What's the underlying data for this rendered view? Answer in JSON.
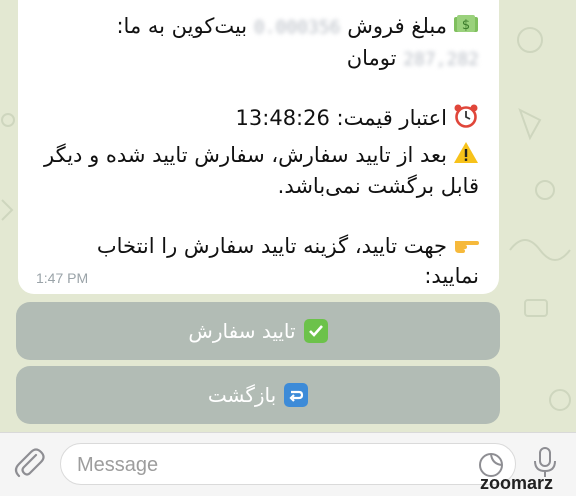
{
  "message": {
    "line1": "مبلغ فروش",
    "blurred_amount": "0.000356",
    "line1_end": "بیت‌کوین به ما:",
    "blurred_toman": "287,282",
    "line2_end": "تومان",
    "line3": "اعتبار قیمت: 13:48:26",
    "line4": "بعد از تایید سفارش، سفارش تایید شده و دیگر",
    "line5": "قابل برگشت نمی‌باشد.",
    "line6": "جهت تایید، گزینه تایید سفارش را انتخاب",
    "line7": "نمایید:",
    "time": "1:47 PM",
    "icons": [
      "money-bag-icon",
      "alarm-clock-icon",
      "warning-icon",
      "pointing-hand-icon"
    ]
  },
  "keyboard": {
    "confirm_label": "تایید سفارش",
    "back_label": "بازگشت",
    "confirm_icon": "check-mark-icon",
    "back_icon": "return-arrow-icon"
  },
  "composer": {
    "placeholder": "Message"
  },
  "watermark": "zoomarz",
  "colors": {
    "chat_background": "#e3e8d2",
    "button_background": "#6e7e8c",
    "check_green": "#6cc24a",
    "return_blue": "#3d8bd8"
  }
}
